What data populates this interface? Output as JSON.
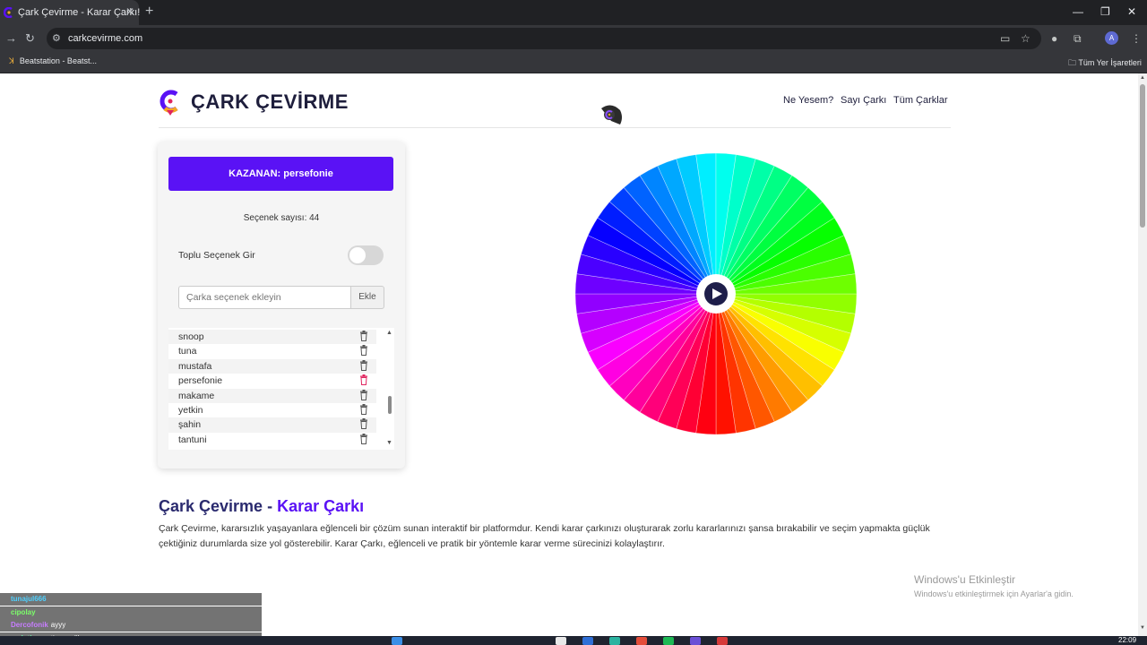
{
  "browser": {
    "tab_title": "Çark Çevirme - Karar Çarkı!",
    "url": "carkcevirme.com",
    "bookmark_item": "Beatstation - Beatst...",
    "bookmarks_folder": "Tüm Yer İşaretleri",
    "profile_initial": "A"
  },
  "site": {
    "brand": "ÇARK ÇEVİRME",
    "nav": [
      "Ne Yesem?",
      "Sayı Çarkı",
      "Tüm Çarklar"
    ],
    "accent_color": "#5a12f5"
  },
  "panel": {
    "winner_text": "KAZANAN: persefonie",
    "option_count": "Seçenek sayısı: 44",
    "bulk_toggle_label": "Toplu Seçenek Gir",
    "bulk_toggle_on": false,
    "input_placeholder": "Çarka seçenek ekleyin",
    "add_button": "Ekle",
    "visible_options": [
      "snoop",
      "tuna",
      "mustafa",
      "persefonie",
      "makame",
      "yetkin",
      "şahin",
      "tantuni"
    ]
  },
  "wheel": {
    "segment_count": 44,
    "center_icon": "play-icon"
  },
  "content": {
    "heading_main": "Çark Çevirme - ",
    "heading_accent": "Karar Çarkı",
    "paragraph": "Çark Çevirme, kararsızlık yaşayanlara eğlenceli bir çözüm sunan interaktif bir platformdur. Kendi karar çarkınızı oluşturarak zorlu kararlarınızı şansa bırakabilir ve seçim yapmakta güçlük çektiğiniz durumlarda size yol gösterebilir. Karar Çarkı, eğlenceli ve pratik bir yöntemle karar verme sürecinizi kolaylaştırır."
  },
  "watermark": {
    "line1": "Windows'u Etkinleştir",
    "line2": "Windows'u etkinleştirmek için Ayarlar'a gidin."
  },
  "chat": [
    {
      "user": "tunajul666",
      "msg": "",
      "color": "#4fd1ff"
    },
    {
      "user": "cipolay",
      "msg": "",
      "color": "#7cff6a"
    },
    {
      "user": "Dercofonik",
      "msg": "ayyy",
      "color": "#c77dff"
    },
    {
      "user": "meloting",
      "msg": "yetisemedik......",
      "color": "#6affb0"
    }
  ],
  "taskbar": {
    "time": "22:09"
  }
}
